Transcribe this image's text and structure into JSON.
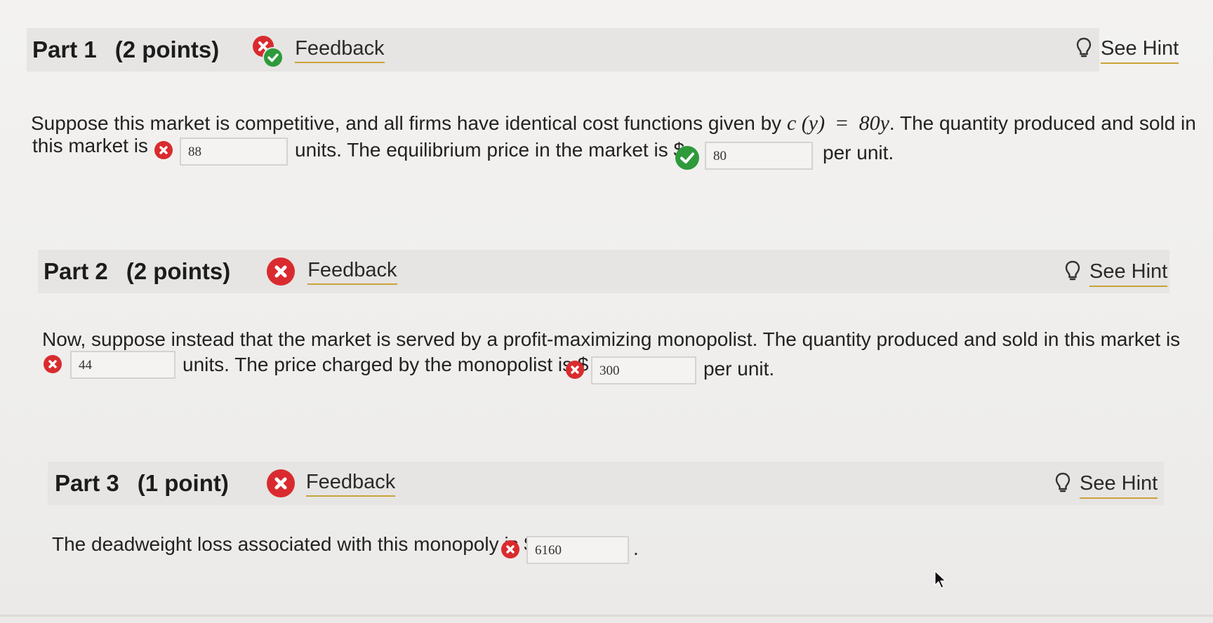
{
  "parts": [
    {
      "title": "Part 1",
      "points": "(2 points)",
      "feedback_label": "Feedback",
      "hint_label": "See Hint",
      "status": "partial"
    },
    {
      "title": "Part 2",
      "points": "(2 points)",
      "feedback_label": "Feedback",
      "hint_label": "See Hint",
      "status": "incorrect"
    },
    {
      "title": "Part 3",
      "points": "(1 point)",
      "feedback_label": "Feedback",
      "hint_label": "See Hint",
      "status": "incorrect"
    }
  ],
  "part1": {
    "line1_text": "Suppose this market is competitive, and all firms have identical cost functions given by",
    "math_func": "c (y)",
    "math_eq": "=",
    "math_rhs": "80y",
    "line1_tail": ". The quantity produced and sold in",
    "line2_start": "this market is",
    "quantity_answer": "88",
    "quantity_status": "incorrect",
    "line2_mid": "units. The equilibrium price in the market is $",
    "price_answer": "80",
    "price_status": "correct",
    "line2_end": "per unit."
  },
  "part2": {
    "line1_text": "Now, suppose instead that the market is served by a profit-maximizing monopolist. The quantity produced and sold in this market is",
    "quantity_answer": "44",
    "quantity_status": "incorrect",
    "line2_mid": "units. The price charged by the monopolist is $",
    "price_answer": "300",
    "price_status": "incorrect",
    "line2_end": "per unit."
  },
  "part3": {
    "line1_text": "The deadweight loss associated with this monopoly is $",
    "dwl_answer": "6160",
    "dwl_status": "incorrect",
    "line1_end": "."
  },
  "colors": {
    "incorrect": "#d92b2f",
    "correct": "#2e9a3b",
    "link_underline": "#c9a23a",
    "header_bg": "#e6e5e3"
  },
  "icons": {
    "incorrect": "x-circle-icon",
    "correct": "check-circle-icon",
    "partial": "partial-credit-icon",
    "hint": "lightbulb-icon",
    "cursor": "mouse-pointer-icon"
  }
}
